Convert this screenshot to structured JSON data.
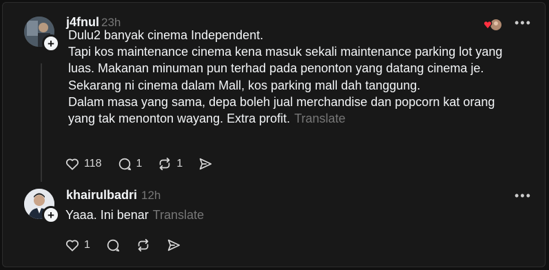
{
  "post": {
    "username": "j4fnul",
    "time": "23h",
    "lines": [
      "Dulu2 banyak cinema Independent.",
      "Tapi kos maintenance cinema kena masuk sekali maintenance parking lot yang",
      "luas. Makanan minuman pun terhad pada penonton yang datang cinema je.",
      "Sekarang ni cinema dalam Mall, kos parking mall dah tanggung.",
      "Dalam masa yang sama, depa boleh jual merchandise dan popcorn kat orang",
      "yang tak menonton wayang. Extra profit."
    ],
    "translate": "Translate",
    "likes": "118",
    "replies": "1",
    "reposts": "1"
  },
  "reply": {
    "username": "khairulbadri",
    "time": "12h",
    "text": "Yaaa. Ini benar",
    "translate": "Translate",
    "likes": "1"
  },
  "colors": {
    "background": "#181818",
    "text": "#f3f5f7",
    "muted": "#777777",
    "heart": "#ff3040"
  }
}
